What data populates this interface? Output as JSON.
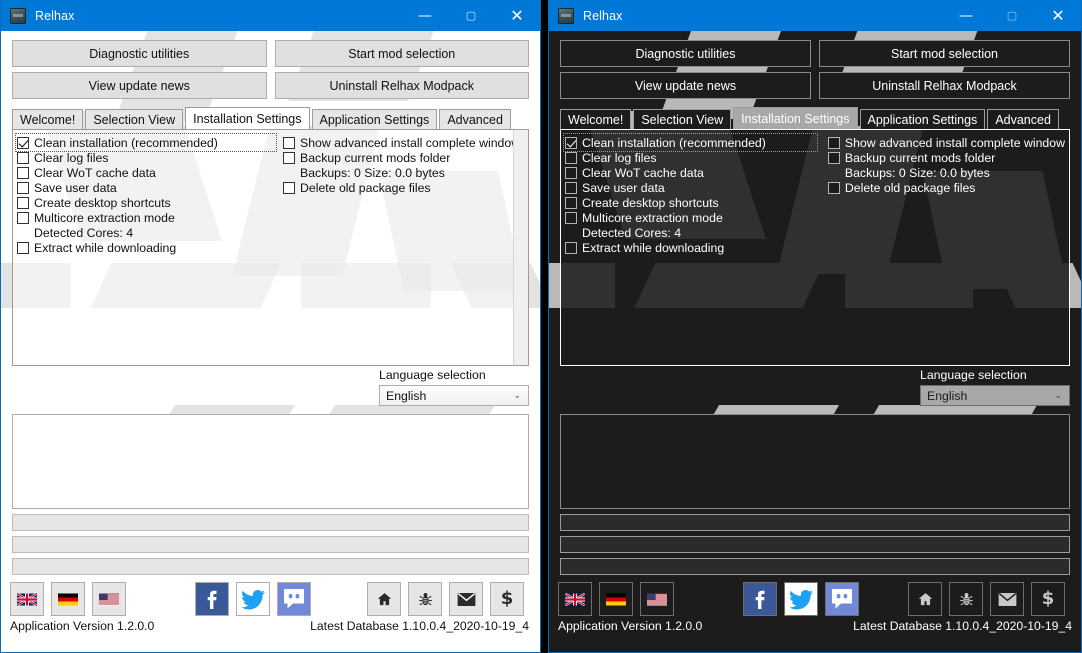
{
  "window": {
    "title": "Relhax",
    "icon": "app-icon",
    "controls": {
      "minimize": "—",
      "maximize": "▢",
      "close": "✕"
    }
  },
  "toolbar": {
    "buttons": [
      {
        "label": "Diagnostic utilities"
      },
      {
        "label": "Start mod selection"
      },
      {
        "label": "View update news"
      },
      {
        "label": "Uninstall Relhax Modpack"
      }
    ]
  },
  "tabs": [
    {
      "label": "Welcome!",
      "active": false
    },
    {
      "label": "Selection View",
      "active": false
    },
    {
      "label": "Installation Settings",
      "active": true
    },
    {
      "label": "Application Settings",
      "active": false
    },
    {
      "label": "Advanced",
      "active": false
    }
  ],
  "installation_settings": {
    "left_column": [
      {
        "type": "checkbox",
        "label": "Clean installation (recommended)",
        "checked": true,
        "focused": true
      },
      {
        "type": "checkbox",
        "label": "Clear log files",
        "checked": false
      },
      {
        "type": "checkbox",
        "label": "Clear WoT cache data",
        "checked": false
      },
      {
        "type": "checkbox",
        "label": "Save user data",
        "checked": false
      },
      {
        "type": "checkbox",
        "label": "Create desktop shortcuts",
        "checked": false
      },
      {
        "type": "checkbox",
        "label": "Multicore extraction mode",
        "checked": false
      },
      {
        "type": "text",
        "label": "Detected Cores: 4"
      },
      {
        "type": "checkbox",
        "label": "Extract while downloading",
        "checked": false
      }
    ],
    "right_column": [
      {
        "type": "checkbox",
        "label": "Show advanced install complete window",
        "checked": false
      },
      {
        "type": "checkbox",
        "label": "Backup current mods folder",
        "checked": false
      },
      {
        "type": "text",
        "label": "Backups: 0  Size: 0.0 bytes"
      },
      {
        "type": "checkbox",
        "label": "Delete old package files",
        "checked": false
      }
    ]
  },
  "language": {
    "label": "Language selection",
    "selected": "English",
    "chevron": "⌄",
    "options": [
      "English"
    ]
  },
  "footer": {
    "flags": [
      {
        "name": "flag-uk",
        "title": "English"
      },
      {
        "name": "flag-germany",
        "title": "Deutsch"
      },
      {
        "name": "flag-usa",
        "title": "USA"
      }
    ],
    "social": [
      {
        "name": "facebook-icon"
      },
      {
        "name": "twitter-icon"
      },
      {
        "name": "discord-icon"
      }
    ],
    "links": [
      {
        "name": "home-icon",
        "glyph": "⌂"
      },
      {
        "name": "bug-icon",
        "glyph": "🐞"
      },
      {
        "name": "email-icon",
        "glyph": "✉"
      },
      {
        "name": "donate-icon",
        "glyph": "$"
      }
    ],
    "version_text": "Application Version 1.2.0.0",
    "database_text": "Latest Database 1.10.0.4_2020-10-19_4"
  },
  "colors": {
    "titlebar": "#0078d7",
    "light_bg": "#ffffff",
    "dark_bg": "#1c1c1c",
    "facebook": "#3b5998",
    "twitter": "#1da1f2",
    "discord": "#7289da",
    "accent_border": "#0d6bb5"
  }
}
